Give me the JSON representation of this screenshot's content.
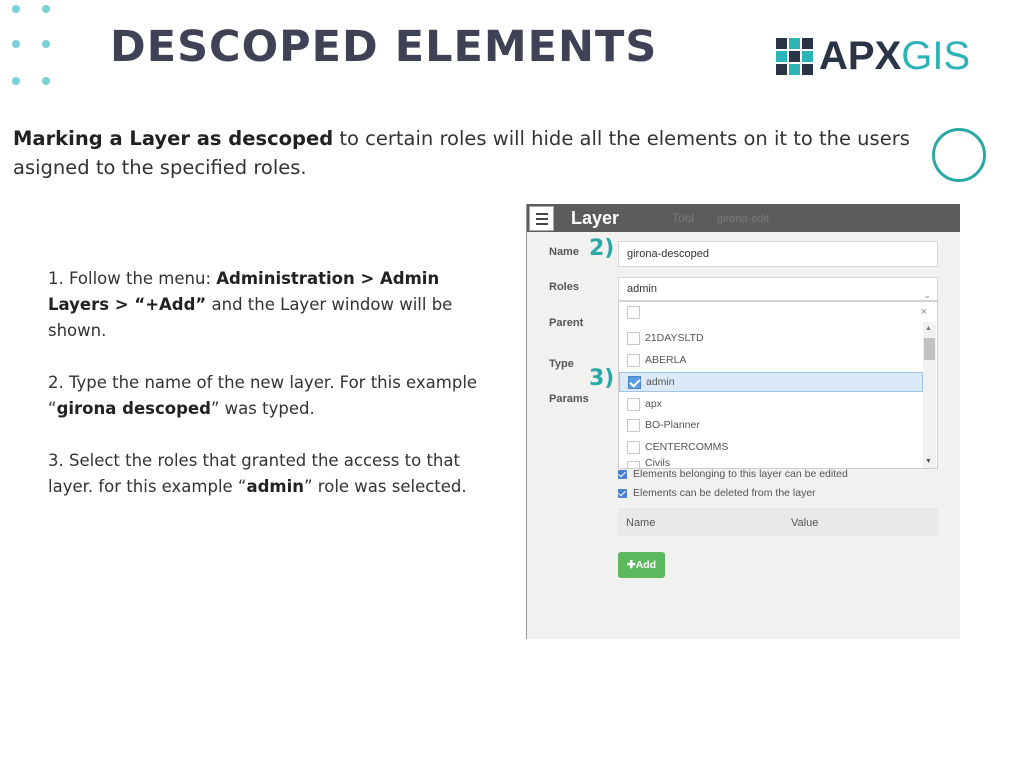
{
  "slide": {
    "title": "DESCOPED ELEMENTS",
    "logo": {
      "left": "APX",
      "right": "GIS"
    },
    "intro": {
      "bold": "Marking a Layer as descoped",
      "rest": " to certain roles will hide all the elements on it to the users asigned to the specified roles."
    },
    "steps": [
      {
        "pre": "1. Follow  the menu: ",
        "bold": "Administration > Admin Layers > “+Add”",
        "post": " and the Layer window will be shown."
      },
      {
        "pre": "2. Type the name of the new layer. For this example “",
        "bold": "girona descoped",
        "post": "” was typed."
      },
      {
        "pre": "3. Select the roles that granted the access to that layer. for this example “",
        "bold": "admin",
        "post": "” role was selected."
      }
    ],
    "colors": {
      "accent": "#2aa9a4",
      "title": "#3f4255",
      "logo_dark": "#2a3446"
    }
  },
  "window": {
    "title": "Layer",
    "ghost_text_1": "Tool",
    "ghost_text_2": "girona-edit",
    "labels": {
      "name": "Name",
      "roles": "Roles",
      "parent": "Parent",
      "type": "Type",
      "params": "Params"
    },
    "step_markers": {
      "name": "2)",
      "roles_option": "3)"
    },
    "name_value": "girona-descoped",
    "roles_value": "admin",
    "clear_glyph": "×",
    "role_options": [
      {
        "label": "",
        "checked": false
      },
      {
        "label": "21DAYSLTD",
        "checked": false
      },
      {
        "label": "ABERLA",
        "checked": false
      },
      {
        "label": "admin",
        "checked": true
      },
      {
        "label": "apx",
        "checked": false
      },
      {
        "label": "BO-Planner",
        "checked": false
      },
      {
        "label": "CENTERCOMMS",
        "checked": false
      },
      {
        "label": "Civils",
        "checked": false
      }
    ],
    "checks": [
      "Elements belonging to this layer can be edited",
      "Elements can be deleted from the layer"
    ],
    "table": {
      "col_name": "Name",
      "col_value": "Value"
    },
    "add_button": "✚Add"
  }
}
